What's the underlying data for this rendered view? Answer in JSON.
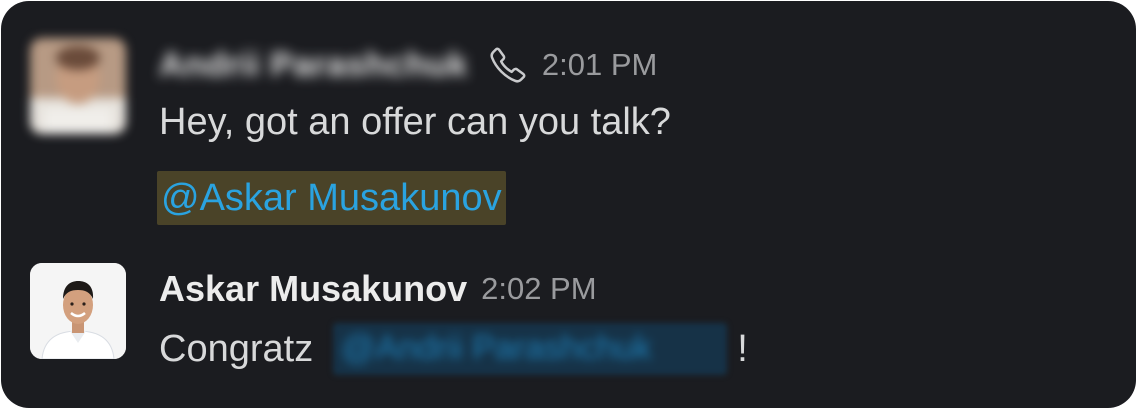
{
  "messages": [
    {
      "sender": "Andrii Parashchuk",
      "icon": "phone-icon",
      "time": "2:01 PM",
      "text": "Hey, got an offer can you talk?",
      "mention": "@Askar Musakunov"
    },
    {
      "sender": "Askar Musakunov",
      "time": "2:02 PM",
      "text_before": "Congratz",
      "mention": "@Andrii Parashchuk",
      "text_after": "!"
    }
  ],
  "colors": {
    "background": "#1b1c20",
    "mention_text": "#2aa3e0",
    "mention_highlight": "#4a4328",
    "timestamp": "#9a9b9e"
  }
}
